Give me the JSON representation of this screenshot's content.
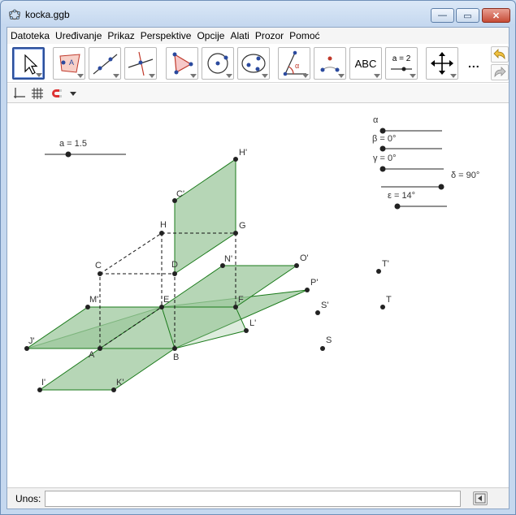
{
  "window": {
    "title": "kocka.ggb",
    "minimize_label": "—",
    "maximize_label": "▭",
    "close_label": "✕"
  },
  "menu": {
    "items": [
      "Datoteka",
      "Uređivanje",
      "Prikaz",
      "Perspektive",
      "Opcije",
      "Alati",
      "Prozor",
      "Pomoć"
    ]
  },
  "toolbar": {
    "tools": [
      "move",
      "polygon-point",
      "line",
      "perpendicular-line",
      "polygon",
      "circle-center-point",
      "conic",
      "angle",
      "reflect",
      "text",
      "slider",
      "move-graphics-view"
    ],
    "text_tool_label": "ABC",
    "slider_tool_label": "a = 2",
    "more_label": "..."
  },
  "inputbar": {
    "label": "Unos:",
    "value": ""
  },
  "canvas": {
    "colors": {
      "fill": "#9ec89e",
      "edge": "#1a7a1a",
      "point": "#222222",
      "label": "#333333"
    },
    "sliders": [
      {
        "label": "a = 1.5",
        "value": 1.5
      },
      {
        "label": "α",
        "value": 0
      },
      {
        "label": "β = 0°",
        "value": 0
      },
      {
        "label": "γ = 0°",
        "value": 0
      },
      {
        "label": "δ = 90°",
        "value": 90
      },
      {
        "label": "ε = 14°",
        "value": 14
      }
    ],
    "points": [
      "H'",
      "C'",
      "H",
      "G",
      "C",
      "D",
      "N'",
      "O'",
      "P'",
      "M'",
      "E",
      "F",
      "S'",
      "L'",
      "J'",
      "A",
      "B",
      "I'",
      "K'",
      "T'",
      "T",
      "S"
    ]
  }
}
